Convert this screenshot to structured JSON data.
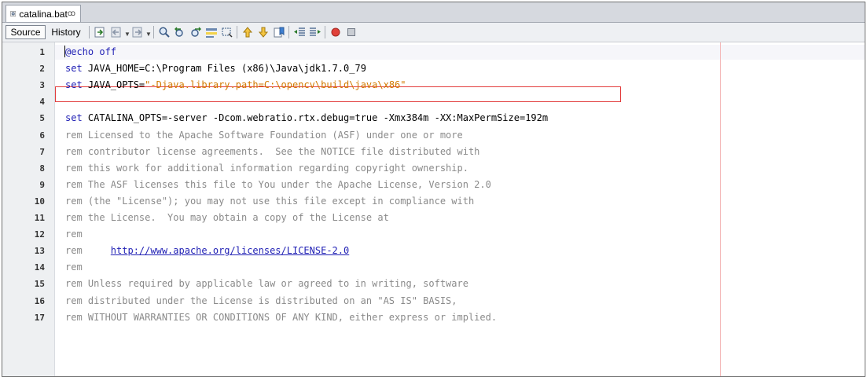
{
  "tab": {
    "file_name": "catalina.bat",
    "close_glyph": "ꝏ",
    "icon": "bat-file-icon"
  },
  "toolbar": {
    "source_label": "Source",
    "history_label": "History",
    "icons": [
      "last-edit-icon",
      "back-icon",
      "forward-icon",
      "find-selection-icon",
      "find-previous-icon",
      "find-next-icon",
      "toggle-highlight-icon",
      "toggle-rect-select-icon",
      "previous-bookmark-icon",
      "next-bookmark-icon",
      "toggle-bookmark-icon",
      "shift-left-icon",
      "shift-right-icon",
      "record-macro-icon",
      "stop-macro-icon"
    ]
  },
  "editor": {
    "highlighted_line": 3,
    "lines": [
      {
        "num": "1",
        "segments": [
          {
            "t": "@echo off",
            "c": "kw"
          }
        ]
      },
      {
        "num": "2",
        "segments": [
          {
            "t": "set ",
            "c": "kw"
          },
          {
            "t": "JAVA_HOME=C:\\Program Files (x86)\\Java\\jdk1.7.0_79",
            "c": "plain"
          }
        ]
      },
      {
        "num": "3",
        "segments": [
          {
            "t": "set ",
            "c": "kw"
          },
          {
            "t": "JAVA_OPTS=",
            "c": "plain"
          },
          {
            "t": "\"-Djava.library.path=C:\\opencv\\build\\java\\x86\"",
            "c": "str"
          }
        ]
      },
      {
        "num": "4",
        "segments": []
      },
      {
        "num": "5",
        "segments": [
          {
            "t": "set ",
            "c": "kw"
          },
          {
            "t": "CATALINA_OPTS=-server -Dcom.webratio.rtx.debug=true -Xmx384m -XX:MaxPermSize=192m",
            "c": "plain"
          }
        ]
      },
      {
        "num": "6",
        "segments": [
          {
            "t": "rem Licensed to the Apache Software Foundation (ASF) under one or more",
            "c": "cm"
          }
        ]
      },
      {
        "num": "7",
        "segments": [
          {
            "t": "rem contributor license agreements.  See the NOTICE file distributed with",
            "c": "cm"
          }
        ]
      },
      {
        "num": "8",
        "segments": [
          {
            "t": "rem this work for additional information regarding copyright ownership.",
            "c": "cm"
          }
        ]
      },
      {
        "num": "9",
        "segments": [
          {
            "t": "rem The ASF licenses this file to You under the Apache License, Version 2.0",
            "c": "cm"
          }
        ]
      },
      {
        "num": "10",
        "segments": [
          {
            "t": "rem (the \"License\"); you may not use this file except in compliance with",
            "c": "cm"
          }
        ]
      },
      {
        "num": "11",
        "segments": [
          {
            "t": "rem the License.  You may obtain a copy of the License at",
            "c": "cm"
          }
        ]
      },
      {
        "num": "12",
        "segments": [
          {
            "t": "rem",
            "c": "cm"
          }
        ]
      },
      {
        "num": "13",
        "segments": [
          {
            "t": "rem     ",
            "c": "cm"
          },
          {
            "t": "http://www.apache.org/licenses/LICENSE-2.0",
            "c": "url"
          }
        ]
      },
      {
        "num": "14",
        "segments": [
          {
            "t": "rem",
            "c": "cm"
          }
        ]
      },
      {
        "num": "15",
        "segments": [
          {
            "t": "rem Unless required by applicable law or agreed to in writing, software",
            "c": "cm"
          }
        ]
      },
      {
        "num": "16",
        "segments": [
          {
            "t": "rem distributed under the License is distributed on an \"AS IS\" BASIS,",
            "c": "cm"
          }
        ]
      },
      {
        "num": "17",
        "segments": [
          {
            "t": "rem WITHOUT WARRANTIES OR CONDITIONS OF ANY KIND, either express or implied.",
            "c": "cm"
          }
        ]
      }
    ]
  }
}
